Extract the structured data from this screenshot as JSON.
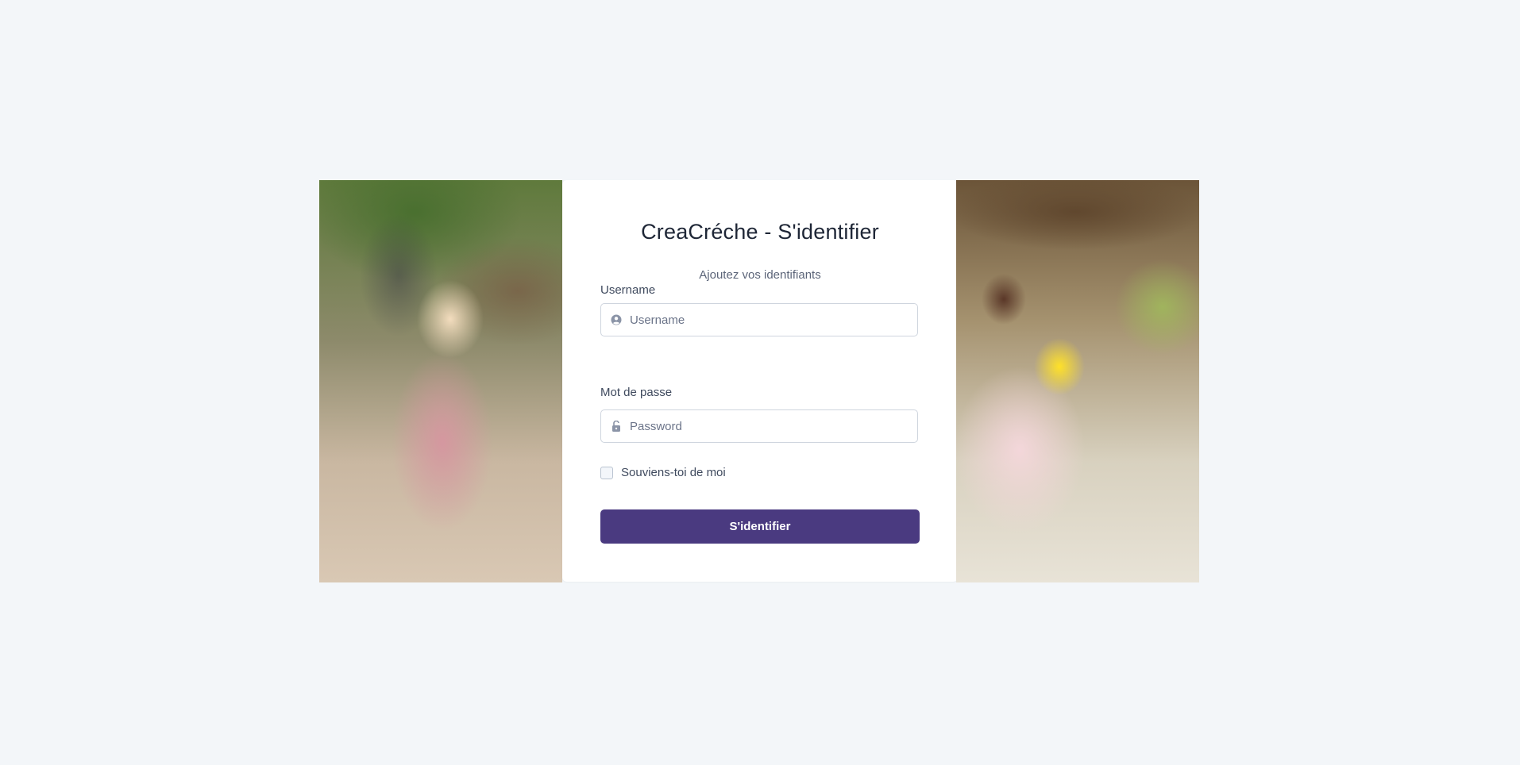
{
  "page": {
    "background_color": "#f3f6f9"
  },
  "photos": {
    "left_description": "",
    "right_description": ""
  },
  "login": {
    "title": "CreaCréche - S'identifier",
    "subtitle": "Ajoutez vos identifiants",
    "username": {
      "label": "Username",
      "placeholder": "Username",
      "value": "",
      "icon": "user-circle-icon"
    },
    "password": {
      "label": "Mot de passe",
      "placeholder": "Password",
      "value": "",
      "icon": "unlock-icon"
    },
    "remember_me": {
      "label": "Souviens-toi de moi",
      "checked": false
    },
    "submit_label": "S'identifier",
    "accent_color": "#4a3a80"
  }
}
